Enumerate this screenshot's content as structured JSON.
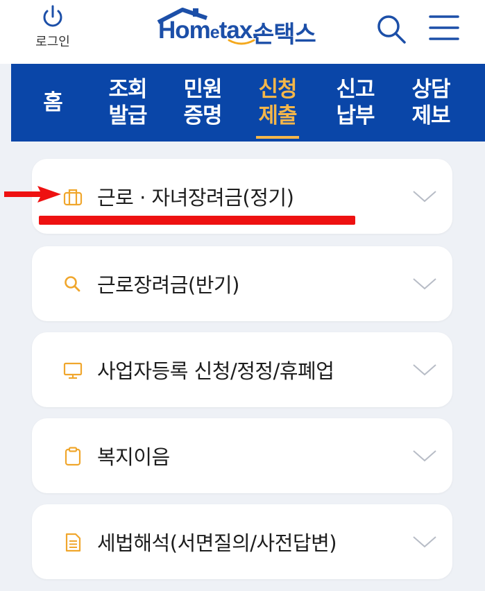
{
  "header": {
    "login_label": "로그인",
    "logo_text_a": "Hom",
    "logo_text_e": "e",
    "logo_text_b": "tax.",
    "logo_brand": "손택스",
    "brand_color": "#1c4fa8"
  },
  "nav": {
    "items": [
      {
        "label": "홈",
        "active": false
      },
      {
        "label": "조회\n발급",
        "active": false
      },
      {
        "label": "민원\n증명",
        "active": false
      },
      {
        "label": "신청\n제출",
        "active": true
      },
      {
        "label": "신고\n납부",
        "active": false
      },
      {
        "label": "상담\n제보",
        "active": false
      }
    ],
    "background": "#0a46a8",
    "active_color": "#f4b64a"
  },
  "menu": {
    "items": [
      {
        "label": "근로 · 자녀장려금(정기)",
        "icon": "briefcase-icon"
      },
      {
        "label": "근로장려금(반기)",
        "icon": "search-icon"
      },
      {
        "label": "사업자등록 신청/정정/휴폐업",
        "icon": "monitor-icon"
      },
      {
        "label": "복지이음",
        "icon": "clipboard-icon"
      },
      {
        "label": "세법해석(서면질의/사전답변)",
        "icon": "document-icon"
      }
    ],
    "icon_color": "#f0a62c"
  },
  "annotation": {
    "arrow_color": "#ee1111",
    "highlighted_item": "근로 · 자녀장려금(정기)"
  }
}
